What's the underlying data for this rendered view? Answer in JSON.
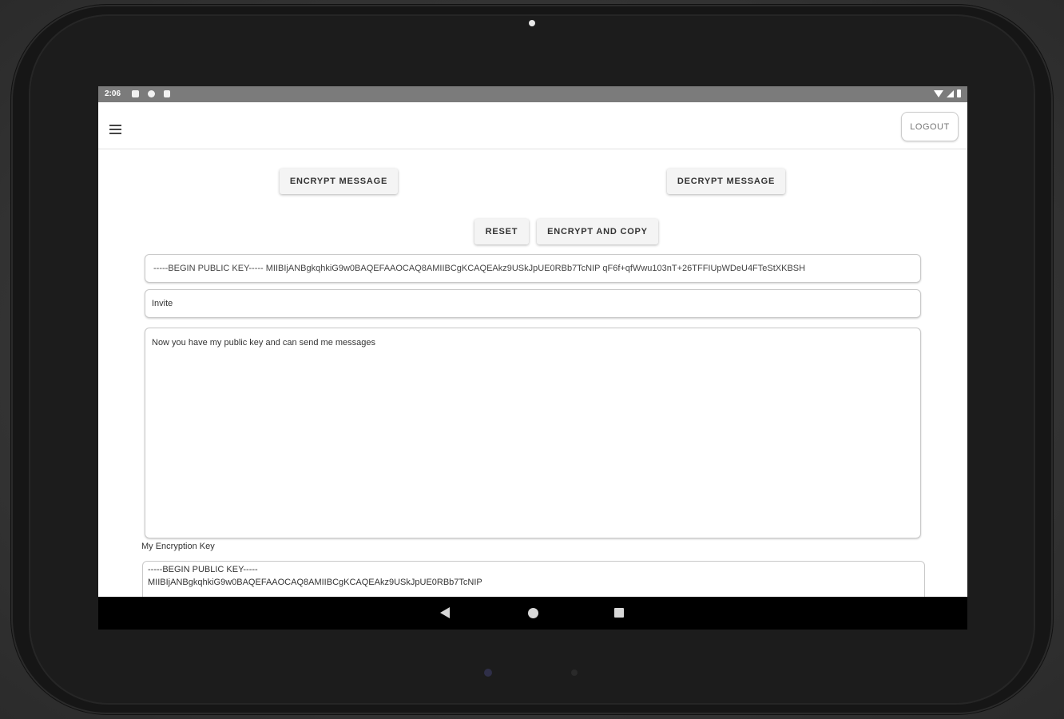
{
  "status_bar": {
    "time": "2:06",
    "left_icons": [
      "notification-icon",
      "sync-icon",
      "sd-card-icon"
    ],
    "right_icons": [
      "wifi-icon",
      "signal-icon",
      "battery-icon"
    ]
  },
  "app_bar": {
    "menu_icon": "hamburger-menu-icon",
    "logout_label": "LOGOUT"
  },
  "actions": {
    "encrypt_message_label": "ENCRYPT MESSAGE",
    "decrypt_message_label": "DECRYPT MESSAGE",
    "reset_label": "RESET",
    "encrypt_and_copy_label": "ENCRYPT AND COPY"
  },
  "form": {
    "public_key_value": "-----BEGIN PUBLIC KEY----- MIIBIjANBgkqhkiG9w0BAQEFAAOCAQ8AMIIBCgKCAQEAkz9USkJpUE0RBb7TcNIP qF6f+qfWwu103nT+26TFFIUpWDeU4FTeStXKBSH",
    "subject_value": "Invite",
    "message_value": "Now you have my public key and can send me messages"
  },
  "my_key": {
    "label": "My Encryption Key",
    "line1": "-----BEGIN PUBLIC KEY-----",
    "line2": "MIIBIjANBgkqhkiG9w0BAQEFAAOCAQ8AMIIBCgKCAQEAkz9USkJpUE0RBb7TcNIP"
  },
  "nav_bar": {
    "icons": [
      "back-icon",
      "home-icon",
      "recent-apps-icon"
    ]
  },
  "colors": {
    "status_bar_bg": "#7b7b7b",
    "nav_bar_bg": "#000000",
    "button_bg": "#f4f4f4",
    "device_bezel": "#1c1c1c"
  }
}
